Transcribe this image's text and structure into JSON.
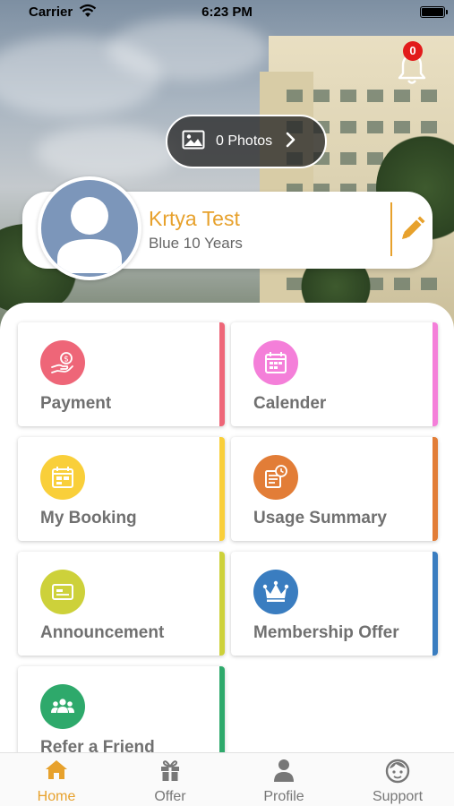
{
  "status_bar": {
    "carrier": "Carrier",
    "time": "6:23 PM"
  },
  "notifications": {
    "badge_count": "0"
  },
  "photos": {
    "label": "0 Photos"
  },
  "profile": {
    "name": "Krtya Test",
    "tier": "Blue 10 Years"
  },
  "menu": {
    "payment": "Payment",
    "calender": "Calender",
    "my_booking": "My Booking",
    "usage_summary": "Usage Summary",
    "announcement": "Announcement",
    "membership_offer": "Membership Offer",
    "refer_a_friend": "Refer a Friend"
  },
  "tabbar": {
    "home": "Home",
    "offer": "Offer",
    "profile": "Profile",
    "support": "Support"
  },
  "colors": {
    "accent": "#e7a12c",
    "payment": "#ee6678",
    "calender": "#f47fd9",
    "my_booking": "#f9cf3a",
    "usage_summary": "#e27d37",
    "announcement": "#cdd13a",
    "membership_offer": "#3a7dc0",
    "refer_a_friend": "#2ea96b"
  },
  "icons": {
    "payment": "hand-coin-icon",
    "calender": "calendar-icon",
    "my_booking": "booking-calendar-icon",
    "usage_summary": "usage-clock-icon",
    "announcement": "announcement-card-icon",
    "membership_offer": "crown-icon",
    "refer_a_friend": "group-icon"
  }
}
